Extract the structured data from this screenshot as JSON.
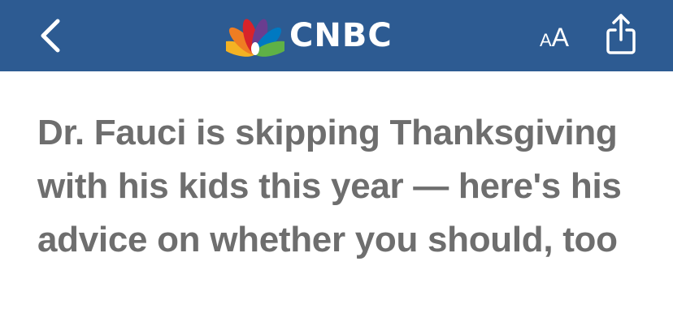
{
  "header": {
    "brand": "CNBC",
    "text_size_small": "A",
    "text_size_large": "A",
    "background_color": "#2d5b92",
    "icons": {
      "back": "chevron-left-icon",
      "logo": "peacock-icon",
      "text_size": "text-size-icon",
      "share": "share-icon"
    }
  },
  "article": {
    "headline": "Dr. Fauci is skipping Thanksgiving with his kids this year — here's his advice on whether you should, too",
    "headline_color": "#6e6e6e"
  }
}
